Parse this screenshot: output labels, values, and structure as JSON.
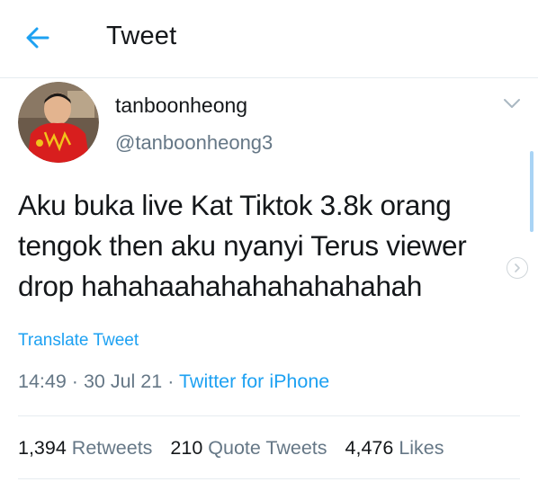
{
  "header": {
    "back_icon": "arrow-left-icon",
    "title": "Tweet",
    "accent_color": "#1da1f2"
  },
  "tweet": {
    "avatar_icon": "user-avatar",
    "display_name": "tanboonheong",
    "handle": "@tanboonheong3",
    "caret_icon": "chevron-down-icon",
    "text": "Aku buka live Kat Tiktok 3.8k orang tengok then aku nyanyi Terus viewer drop hahahaahahahahahahahah",
    "translate_label": "Translate Tweet",
    "time": "14:49",
    "date": "30 Jul 21",
    "source": "Twitter for iPhone",
    "sep": "·"
  },
  "stats": {
    "retweets_count": "1,394",
    "retweets_label": "Retweets",
    "quotes_count": "210",
    "quotes_label": "Quote Tweets",
    "likes_count": "4,476",
    "likes_label": "Likes"
  },
  "side": {
    "scroll_icon": "scrollbar-thumb",
    "circle_icon": "chevron-right-circle-icon"
  }
}
